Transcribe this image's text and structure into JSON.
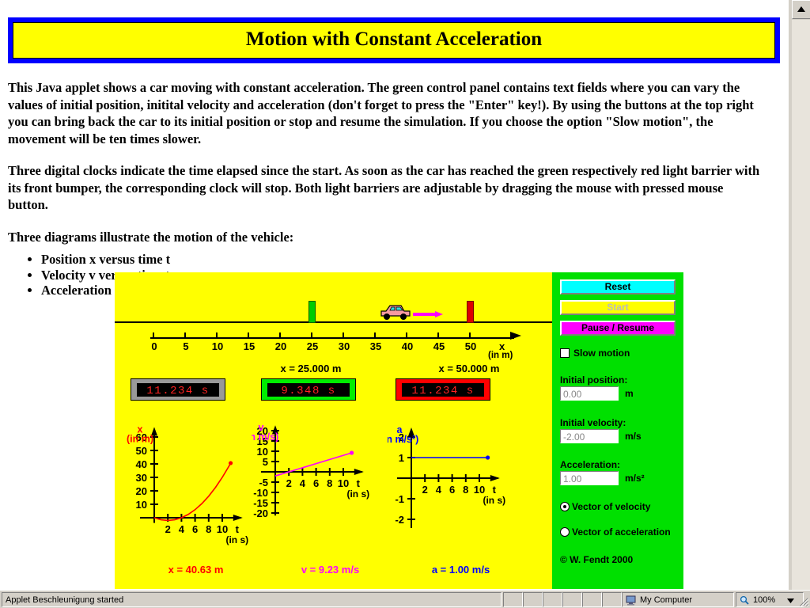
{
  "page": {
    "title": "Motion with Constant Acceleration",
    "paragraphs": [
      "This Java applet shows a car moving with constant acceleration. The green control panel contains text fields where you can vary the values of initial position, initital velocity and acceleration (don't forget to press the \"Enter\" key!). By using the buttons at the top right you can bring back the car to its initial position or stop and resume the simulation. If you choose the option \"Slow motion\", the movement will be ten times slower.",
      "Three digital clocks indicate the time elapsed since the start. As soon as the car has reached the green respectively red light barrier with its front bumper, the corresponding clock will stop. Both light barriers are adjustable by dragging the mouse with pressed mouse button.",
      "Three diagrams illustrate the motion of the vehicle:"
    ],
    "bullets": [
      "Position x versus time t",
      "Velocity v versus time t",
      "Acceleration a versus time t"
    ]
  },
  "applet": {
    "stage": {
      "x_axis": {
        "name": "x",
        "unit": "(in m)",
        "ticks": [
          0,
          5,
          10,
          15,
          20,
          25,
          30,
          35,
          40,
          45,
          50
        ]
      },
      "car": {
        "position_m": 40.63,
        "arrow": "velocity-vector"
      },
      "barriers": [
        {
          "color": "#00cc00",
          "position_m": 25,
          "caption": "x = 25.000 m"
        },
        {
          "color": "#dd0000",
          "position_m": 50,
          "caption": "x = 50.000 m"
        }
      ],
      "clocks": [
        {
          "name": "total",
          "value": "11.234  s",
          "frame": "#999999"
        },
        {
          "name": "green-barrier",
          "value": "9.348  s",
          "frame": "#00ee00"
        },
        {
          "name": "red-barrier",
          "value": "11.234  s",
          "frame": "#ff0000"
        }
      ],
      "readouts": {
        "x": "x = 40.63 m",
        "v": "v = 9.23 m/s",
        "a": "a = 1.00 m/s"
      }
    },
    "controls": {
      "reset_label": "Reset",
      "start_label": "Start",
      "pause_label": "Pause / Resume",
      "slow_motion_label": "Slow motion",
      "slow_motion_checked": false,
      "initial_position_label": "Initial position:",
      "initial_position_value": "0.00",
      "initial_position_unit": "m",
      "initial_velocity_label": "Initial velocity:",
      "initial_velocity_value": "-2.00",
      "initial_velocity_unit": "m/s",
      "acceleration_label": "Acceleration:",
      "acceleration_value": "1.00",
      "acceleration_unit": "m/s²",
      "radio_velocity_label": "Vector of velocity",
      "radio_acceleration_label": "Vector of acceleration",
      "selected_vector": "velocity",
      "copyright": "© W. Fendt 2000"
    }
  },
  "chart_data": [
    {
      "type": "line",
      "name": "position-time",
      "title": "",
      "ylabel": "x",
      "yunit": "(in m)",
      "xlabel": "t",
      "xunit": "(in s)",
      "color": "#ff0000",
      "xlim": [
        0,
        13
      ],
      "ylim": [
        -5,
        68
      ],
      "xticks": [
        2,
        4,
        6,
        8,
        10
      ],
      "yticks": [
        10,
        20,
        30,
        40,
        50,
        60
      ],
      "x": [
        0,
        1,
        2,
        3,
        4,
        5,
        6,
        7,
        8,
        9,
        10,
        11,
        11.234
      ],
      "values": [
        0,
        -1.5,
        -2,
        -1.5,
        0,
        2.5,
        6,
        10.5,
        16,
        22.5,
        30,
        38.5,
        40.63
      ],
      "endpoint": {
        "x": 11.234,
        "y": 40.63
      }
    },
    {
      "type": "line",
      "name": "velocity-time",
      "title": "",
      "ylabel": "v",
      "yunit": "(in m/s)",
      "xlabel": "t",
      "xunit": "(in s)",
      "color": "#ff00ff",
      "xlim": [
        0,
        13
      ],
      "ylim": [
        -22,
        23
      ],
      "xticks": [
        2,
        4,
        6,
        8,
        10
      ],
      "yticks": [
        -20,
        -15,
        -10,
        -5,
        5,
        10,
        15,
        20
      ],
      "x": [
        0,
        11.234
      ],
      "values": [
        -2,
        9.23
      ],
      "endpoint": {
        "x": 11.234,
        "y": 9.23
      }
    },
    {
      "type": "line",
      "name": "acceleration-time",
      "title": "",
      "ylabel": "a",
      "yunit": "(in m/s²)",
      "xlabel": "t",
      "xunit": "(in s)",
      "color": "#0000ff",
      "xlim": [
        0,
        13
      ],
      "ylim": [
        -2.5,
        2.5
      ],
      "xticks": [
        2,
        4,
        6,
        8,
        10
      ],
      "yticks": [
        -2,
        -1,
        1,
        2
      ],
      "x": [
        0,
        11.234
      ],
      "values": [
        1.0,
        1.0
      ],
      "endpoint": {
        "x": 11.234,
        "y": 1.0
      }
    }
  ],
  "statusbar": {
    "message": "Applet Beschleunigung started",
    "zone": "My Computer",
    "zoom": "100%"
  }
}
